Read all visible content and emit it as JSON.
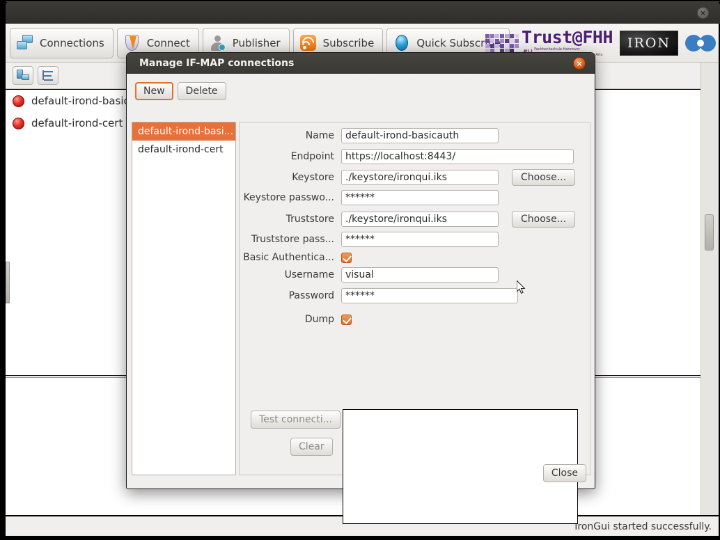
{
  "window": {
    "close_icon": "close-icon",
    "close_glyph": "×"
  },
  "toolbar": {
    "buttons": [
      {
        "label": "Connections",
        "icon": "connections-icon"
      },
      {
        "label": "Connect",
        "icon": "connect-icon"
      },
      {
        "label": "Publisher",
        "icon": "publisher-icon"
      },
      {
        "label": "Subscribe",
        "icon": "subscribe-icon"
      },
      {
        "label": "Quick Subscribe",
        "icon": "quick-subscribe-icon"
      }
    ]
  },
  "logos": {
    "trust": "Trust@FHH",
    "fhh_mark": "-F|-|",
    "fhh_line1": "Fachhochschule Hannover",
    "fhh_line2": "University of Applied Sciences and Arts",
    "iron": "IRON",
    "blue": "blue-logo-icon"
  },
  "panel": {
    "tool_buttons": [
      {
        "name": "server-view-button",
        "icon": "server-icon"
      },
      {
        "name": "tree-view-button",
        "icon": "tree-icon"
      }
    ],
    "connections": [
      {
        "name": "default-irond-basicauth",
        "status_icon": "red-led-icon"
      },
      {
        "name": "default-irond-cert",
        "status_icon": "red-led-icon"
      }
    ]
  },
  "status": {
    "message": "IronGui started successfully."
  },
  "dialog": {
    "title": "Manage IF-MAP connections",
    "close_glyph": "×",
    "new_label": "New",
    "delete_label": "Delete",
    "list": [
      {
        "label": "default-irond-basi...",
        "selected": true
      },
      {
        "label": "default-irond-cert",
        "selected": false
      }
    ],
    "fields": {
      "name_label": "Name",
      "name_value": "default-irond-basicauth",
      "endpoint_label": "Endpoint",
      "endpoint_value": "https://localhost:8443/",
      "keystore_label": "Keystore",
      "keystore_value": "./keystore/ironqui.iks",
      "keystore_choose": "Choose...",
      "keystore_password_label": "Keystore passwo...",
      "keystore_password_value": "******",
      "truststore_label": "Truststore",
      "truststore_value": "./keystore/ironqui.iks",
      "truststore_choose": "Choose...",
      "truststore_password_label": "Truststore pass...",
      "truststore_password_value": "******",
      "basic_auth_label": "Basic Authentica...",
      "basic_auth_checked": true,
      "username_label": "Username",
      "username_value": "visual",
      "password_label": "Password",
      "password_value": "******",
      "dump_label": "Dump",
      "dump_checked": true
    },
    "test_label": "Test connecti...",
    "clear_label": "Clear",
    "log_value": "",
    "close_label": "Close"
  },
  "colors": {
    "accent_orange": "#e8703a",
    "titlebar_dark": "#3a3833",
    "led_red": "#e8332a",
    "trust_purple": "#4b1f75",
    "logo_blue": "#3a7dc4"
  }
}
